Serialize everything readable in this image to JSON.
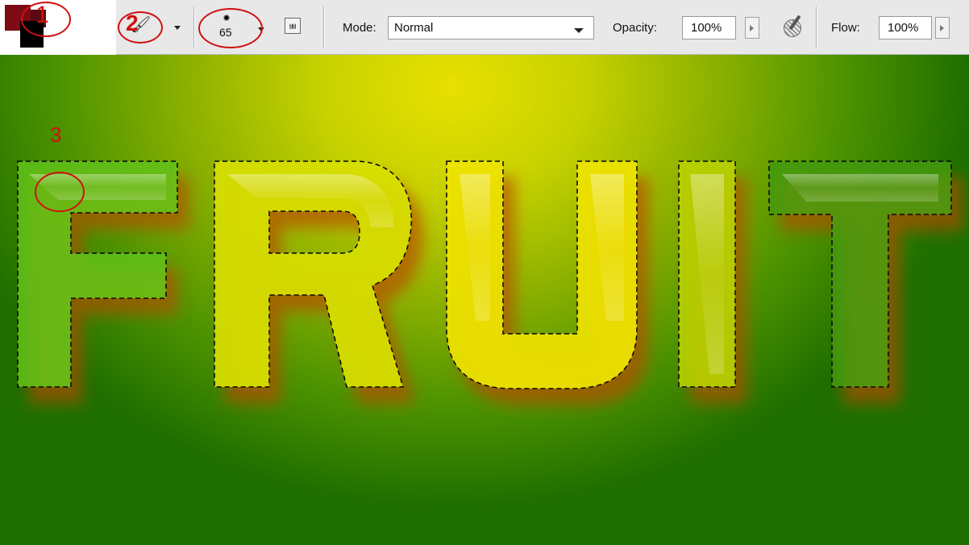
{
  "swatches": {
    "foreground_color": "#7d0a14",
    "background_color": "#000000"
  },
  "toolbar": {
    "tool_preset_icon": "brush-icon",
    "brush_size": "65",
    "airbrush_icon": "airbrush-icon",
    "mode_label": "Mode:",
    "mode_value": "Normal",
    "opacity_label": "Opacity:",
    "opacity_value": "100%",
    "pressure_icon": "tablet-pressure-icon",
    "flow_label": "Flow:",
    "flow_value": "100%"
  },
  "annotations": [
    "1",
    "2",
    "3"
  ],
  "canvas": {
    "text": "FRUIT",
    "gradient_colors": [
      "#e8e000",
      "#8fb200",
      "#1f6f00"
    ],
    "letter_colors": {
      "F": "#5fc21a",
      "R": "#d8e000",
      "U": "#f0e400",
      "I": "#bcd400",
      "T": "#3f9a10"
    }
  }
}
